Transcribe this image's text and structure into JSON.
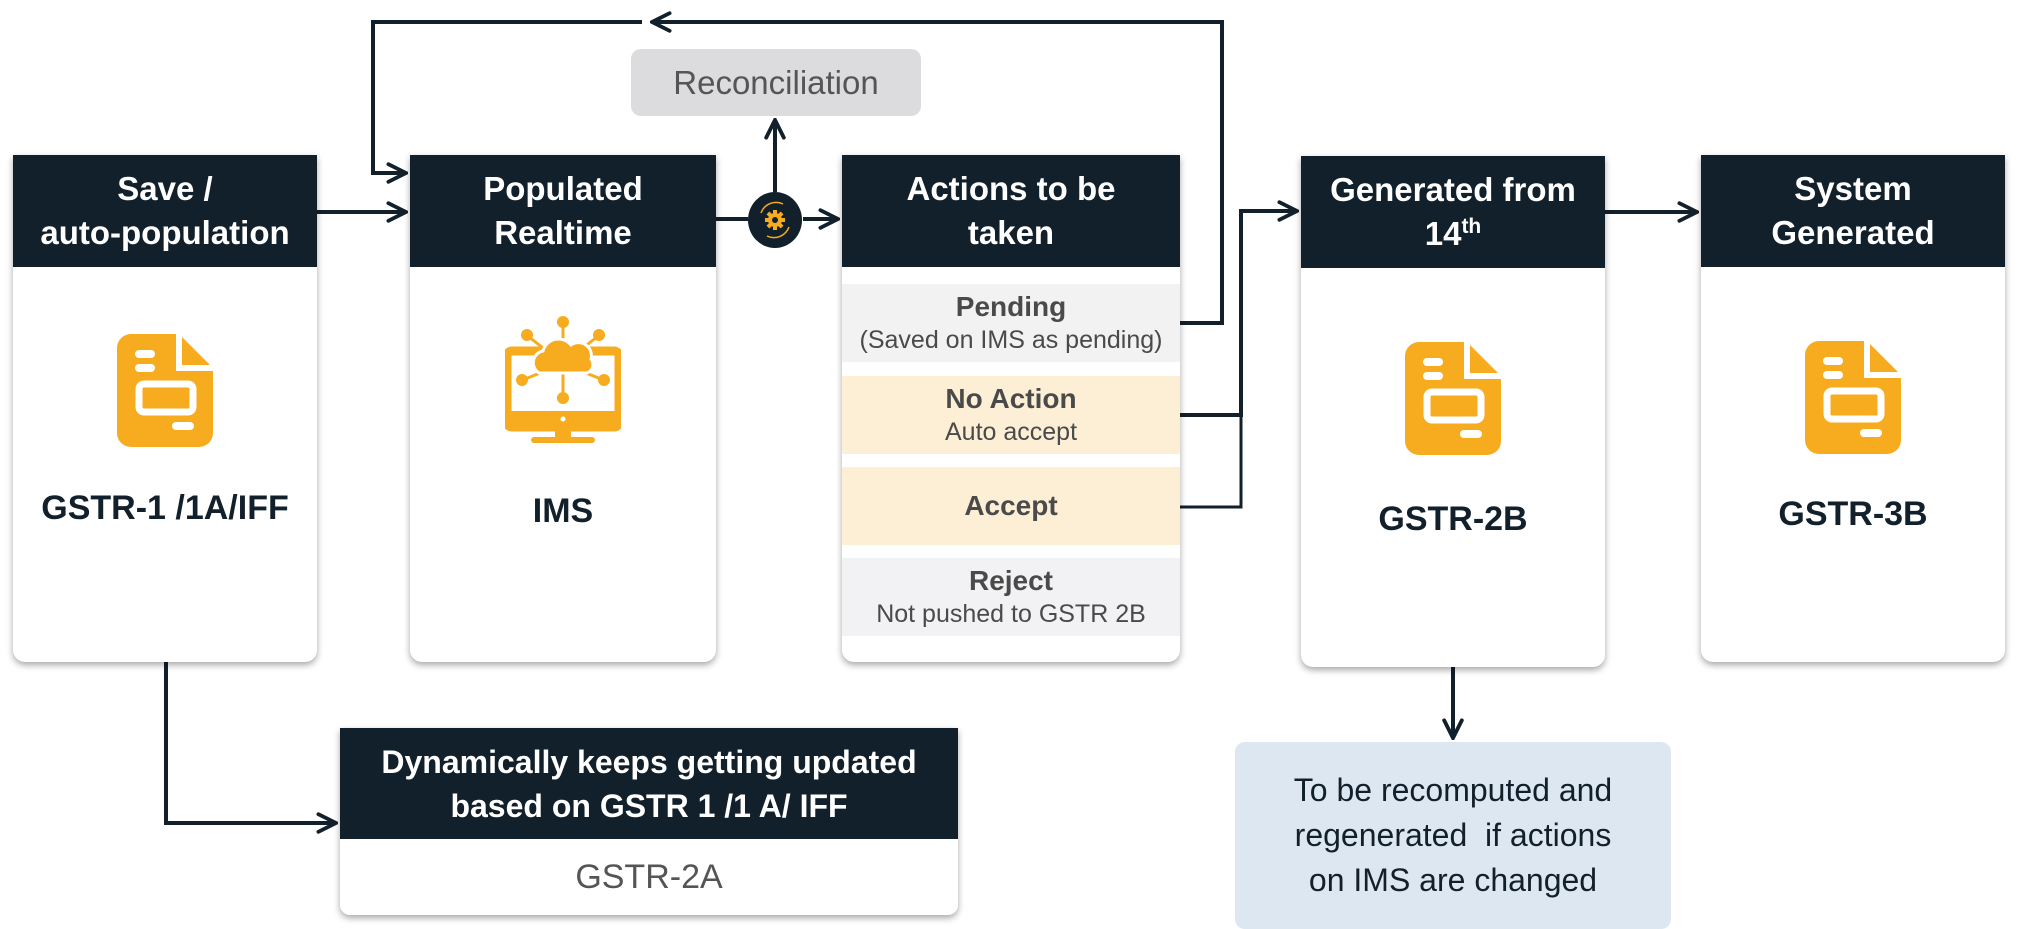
{
  "colors": {
    "header_bg": "#12202b",
    "icon_accent": "#f7ab1e",
    "pending_bg": "#f2f2f2",
    "accept_bg": "#fdefd6",
    "reject_bg": "#f2f2f4",
    "note_bg": "#dde7f2",
    "reconciliation_bg": "#dcdcde"
  },
  "reconciliation": {
    "label": "Reconciliation"
  },
  "cards": [
    {
      "header_line1": "Save /",
      "header_line2": "auto-population",
      "icon": "document-icon",
      "label": "GSTR-1 /1A/IFF"
    },
    {
      "header_line1": "Populated",
      "header_line2": "Realtime",
      "icon": "cloud-network-monitor-icon",
      "label": "IMS"
    },
    {
      "header_line1": "Actions to be",
      "header_line2": "taken",
      "actions": [
        {
          "title": "Pending",
          "subtitle": "(Saved on IMS as pending)"
        },
        {
          "title": "No Action",
          "subtitle": "Auto accept"
        },
        {
          "title": "Accept",
          "subtitle": ""
        },
        {
          "title": "Reject",
          "subtitle": "Not pushed to GSTR 2B"
        }
      ]
    },
    {
      "header_line1": "Generated from",
      "header_line2": "14",
      "header_sup": "th",
      "icon": "document-icon",
      "label": "GSTR-2B"
    },
    {
      "header_line1": "System",
      "header_line2": "Generated",
      "icon": "document-icon",
      "label": "GSTR-3B"
    }
  ],
  "gstr2a_box": {
    "header_line1": "Dynamically keeps getting updated",
    "header_line2": "based on GSTR 1 /1 A/ IFF",
    "value": "GSTR-2A"
  },
  "note": {
    "line1": "To be recomputed and",
    "line2": "regenerated  if actions",
    "line3": "on IMS are changed"
  },
  "connector_icon": "gear-sync-icon"
}
